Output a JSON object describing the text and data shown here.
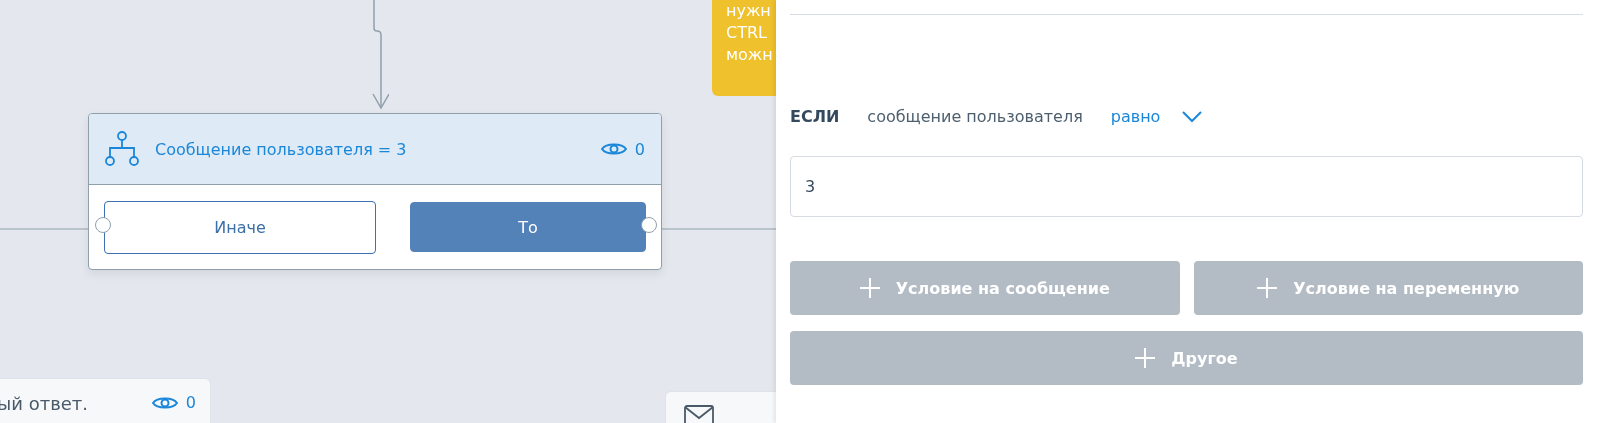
{
  "canvas": {
    "note": {
      "lines": [
        "нужн",
        "CTRL",
        "можн"
      ]
    },
    "node": {
      "title": "Сообщение пользователя = 3",
      "views": "0",
      "branches": [
        {
          "label": "Иначе",
          "kind": "outline"
        },
        {
          "label": "То",
          "kind": "filled"
        }
      ]
    },
    "bottom_cards": [
      {
        "kind": "text",
        "text": "ый ответ.",
        "views": "0"
      },
      {
        "kind": "mail"
      }
    ]
  },
  "panel": {
    "condition": {
      "keyword": "ЕСЛИ",
      "subject": "сообщение пользователя",
      "operator": "равно"
    },
    "value": "3",
    "buttons": [
      {
        "label": "Условие на сообщение",
        "wide": false
      },
      {
        "label": "Условие на переменную",
        "wide": false
      },
      {
        "label": "Другое",
        "wide": true
      }
    ]
  }
}
